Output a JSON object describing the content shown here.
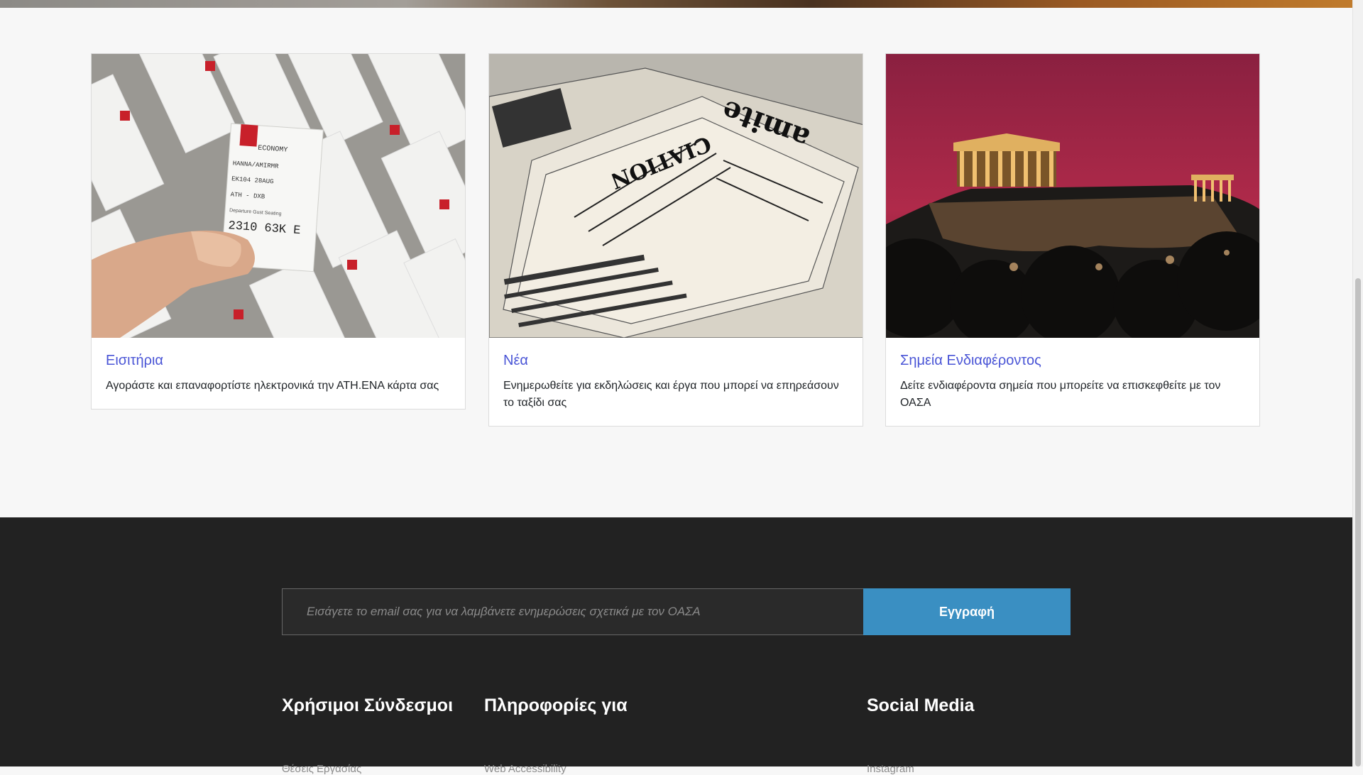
{
  "cards": [
    {
      "title": "Εισιτήρια",
      "text": "Αγοράστε και επαναφορτίστε ηλεκτρονικά την ΑΤΗ.ΕΝΑ κάρτα σας",
      "image": "tickets-photo",
      "image_text": {
        "class": "ECONOMY",
        "name": "HANNA/AMIRMR",
        "flight": "EK104",
        "date": "28AUG",
        "route": "ATH - DXB",
        "departure": "Departure",
        "gust": "Gust",
        "seating": "Seating zone",
        "code": "2310 63K  E"
      }
    },
    {
      "title": "Νέα",
      "text": "Ενημερωθείτε για εκδηλώσεις και έργα που μπορεί να επηρεάσουν το ταξίδι σας",
      "image": "newspapers-photo"
    },
    {
      "title": "Σημεία Ενδιαφέροντος",
      "text": "Δείτε ενδιαφέροντα σημεία που μπορείτε να επισκεφθείτε με τον ΟΑΣΑ",
      "image": "acropolis-photo"
    }
  ],
  "newsletter": {
    "placeholder": "Εισάγετε το email σας για να λαμβάνετε ενημερώσεις σχετικά με τον ΟΑΣΑ",
    "button_label": "Εγγραφή"
  },
  "footer": {
    "columns": [
      {
        "title": "Χρήσιμοι Σύνδεσμοι",
        "first_link": "Θέσεις Εργασίας"
      },
      {
        "title": "Πληροφορίες για",
        "first_link": "Web Accessibility"
      },
      {
        "title": "Social Media",
        "first_link": "Instagram"
      }
    ]
  },
  "colors": {
    "link_title": "#4a55d6",
    "footer_bg": "#222222",
    "button_bg": "#3a8fc2"
  }
}
